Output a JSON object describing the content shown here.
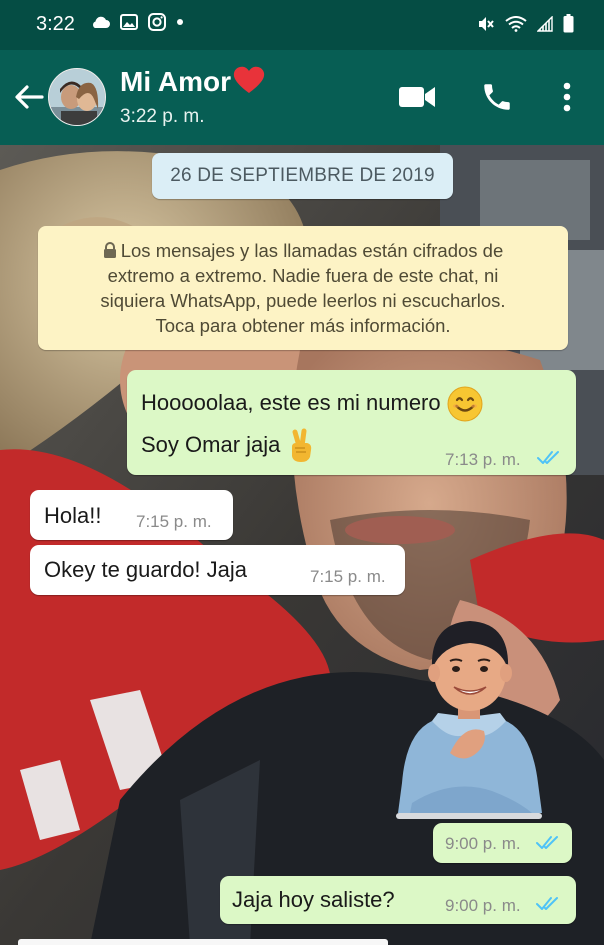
{
  "status_bar": {
    "time": "3:22"
  },
  "header": {
    "contact_name": "Mi Amor",
    "contact_status": "3:22 p. m."
  },
  "chat": {
    "date_label": "26 DE SEPTIEMBRE DE 2019",
    "encryption_notice": [
      "Los mensajes y las llamadas están cifrados de",
      "extremo a extremo. Nadie fuera de este chat, ni",
      "siquiera WhatsApp, puede leerlos ni escucharlos.",
      "Toca para obtener más información."
    ],
    "messages": [
      {
        "direction": "outgoing",
        "lines": [
          "Hooooolaa,  este es mi numero",
          "Soy Omar jaja"
        ],
        "time": "7:13 p. m.",
        "status": "read"
      },
      {
        "direction": "incoming",
        "text": "Hola!!",
        "time": "7:15 p. m."
      },
      {
        "direction": "incoming",
        "text": "Okey te guardo! Jaja",
        "time": "7:15 p. m."
      },
      {
        "direction": "outgoing",
        "type": "sticker",
        "time": "9:00 p. m.",
        "status": "read"
      },
      {
        "direction": "outgoing",
        "text": "Jaja hoy saliste?",
        "time": "9:00 p. m.",
        "status": "read"
      }
    ]
  },
  "colors": {
    "header": "#075e54",
    "status_bar": "#054d44",
    "outgoing_bubble": "#dcf8c6",
    "incoming_bubble": "#ffffff",
    "read_ticks": "#4fc3f7",
    "notice": "#fdf3c5",
    "date_pill": "#dbeef6"
  },
  "icons": [
    "cloud-icon",
    "image-icon",
    "instagram-icon",
    "mute-icon",
    "wifi-icon",
    "signal-icon",
    "battery-icon",
    "back-arrow-icon",
    "video-call-icon",
    "phone-icon",
    "more-options-icon",
    "lock-icon",
    "smile-emoji",
    "victory-hand-emoji",
    "double-check-icon",
    "heart-emoji"
  ]
}
